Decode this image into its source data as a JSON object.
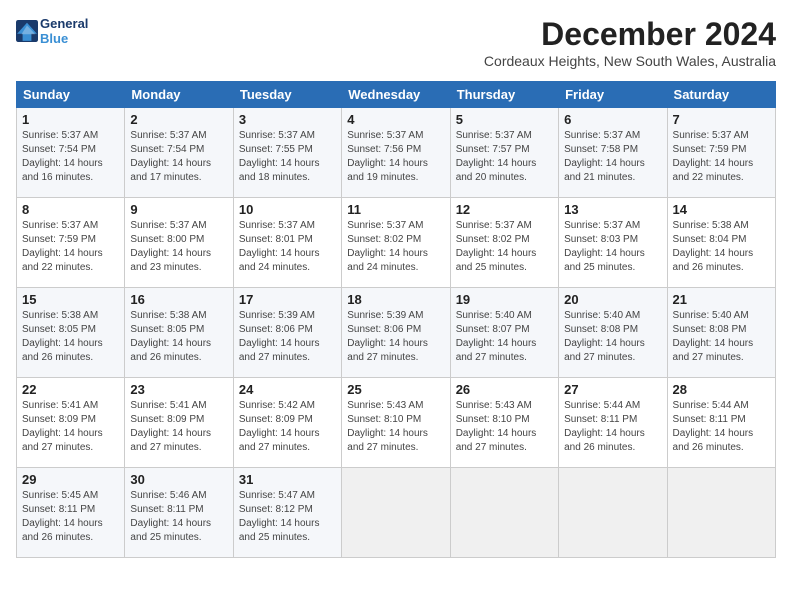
{
  "logo": {
    "text_general": "General",
    "text_blue": "Blue"
  },
  "title": "December 2024",
  "subtitle": "Cordeaux Heights, New South Wales, Australia",
  "days_of_week": [
    "Sunday",
    "Monday",
    "Tuesday",
    "Wednesday",
    "Thursday",
    "Friday",
    "Saturday"
  ],
  "weeks": [
    [
      {
        "day": "1",
        "info": "Sunrise: 5:37 AM\nSunset: 7:54 PM\nDaylight: 14 hours\nand 16 minutes."
      },
      {
        "day": "2",
        "info": "Sunrise: 5:37 AM\nSunset: 7:54 PM\nDaylight: 14 hours\nand 17 minutes."
      },
      {
        "day": "3",
        "info": "Sunrise: 5:37 AM\nSunset: 7:55 PM\nDaylight: 14 hours\nand 18 minutes."
      },
      {
        "day": "4",
        "info": "Sunrise: 5:37 AM\nSunset: 7:56 PM\nDaylight: 14 hours\nand 19 minutes."
      },
      {
        "day": "5",
        "info": "Sunrise: 5:37 AM\nSunset: 7:57 PM\nDaylight: 14 hours\nand 20 minutes."
      },
      {
        "day": "6",
        "info": "Sunrise: 5:37 AM\nSunset: 7:58 PM\nDaylight: 14 hours\nand 21 minutes."
      },
      {
        "day": "7",
        "info": "Sunrise: 5:37 AM\nSunset: 7:59 PM\nDaylight: 14 hours\nand 22 minutes."
      }
    ],
    [
      {
        "day": "8",
        "info": "Sunrise: 5:37 AM\nSunset: 7:59 PM\nDaylight: 14 hours\nand 22 minutes."
      },
      {
        "day": "9",
        "info": "Sunrise: 5:37 AM\nSunset: 8:00 PM\nDaylight: 14 hours\nand 23 minutes."
      },
      {
        "day": "10",
        "info": "Sunrise: 5:37 AM\nSunset: 8:01 PM\nDaylight: 14 hours\nand 24 minutes."
      },
      {
        "day": "11",
        "info": "Sunrise: 5:37 AM\nSunset: 8:02 PM\nDaylight: 14 hours\nand 24 minutes."
      },
      {
        "day": "12",
        "info": "Sunrise: 5:37 AM\nSunset: 8:02 PM\nDaylight: 14 hours\nand 25 minutes."
      },
      {
        "day": "13",
        "info": "Sunrise: 5:37 AM\nSunset: 8:03 PM\nDaylight: 14 hours\nand 25 minutes."
      },
      {
        "day": "14",
        "info": "Sunrise: 5:38 AM\nSunset: 8:04 PM\nDaylight: 14 hours\nand 26 minutes."
      }
    ],
    [
      {
        "day": "15",
        "info": "Sunrise: 5:38 AM\nSunset: 8:05 PM\nDaylight: 14 hours\nand 26 minutes."
      },
      {
        "day": "16",
        "info": "Sunrise: 5:38 AM\nSunset: 8:05 PM\nDaylight: 14 hours\nand 26 minutes."
      },
      {
        "day": "17",
        "info": "Sunrise: 5:39 AM\nSunset: 8:06 PM\nDaylight: 14 hours\nand 27 minutes."
      },
      {
        "day": "18",
        "info": "Sunrise: 5:39 AM\nSunset: 8:06 PM\nDaylight: 14 hours\nand 27 minutes."
      },
      {
        "day": "19",
        "info": "Sunrise: 5:40 AM\nSunset: 8:07 PM\nDaylight: 14 hours\nand 27 minutes."
      },
      {
        "day": "20",
        "info": "Sunrise: 5:40 AM\nSunset: 8:08 PM\nDaylight: 14 hours\nand 27 minutes."
      },
      {
        "day": "21",
        "info": "Sunrise: 5:40 AM\nSunset: 8:08 PM\nDaylight: 14 hours\nand 27 minutes."
      }
    ],
    [
      {
        "day": "22",
        "info": "Sunrise: 5:41 AM\nSunset: 8:09 PM\nDaylight: 14 hours\nand 27 minutes."
      },
      {
        "day": "23",
        "info": "Sunrise: 5:41 AM\nSunset: 8:09 PM\nDaylight: 14 hours\nand 27 minutes."
      },
      {
        "day": "24",
        "info": "Sunrise: 5:42 AM\nSunset: 8:09 PM\nDaylight: 14 hours\nand 27 minutes."
      },
      {
        "day": "25",
        "info": "Sunrise: 5:43 AM\nSunset: 8:10 PM\nDaylight: 14 hours\nand 27 minutes."
      },
      {
        "day": "26",
        "info": "Sunrise: 5:43 AM\nSunset: 8:10 PM\nDaylight: 14 hours\nand 27 minutes."
      },
      {
        "day": "27",
        "info": "Sunrise: 5:44 AM\nSunset: 8:11 PM\nDaylight: 14 hours\nand 26 minutes."
      },
      {
        "day": "28",
        "info": "Sunrise: 5:44 AM\nSunset: 8:11 PM\nDaylight: 14 hours\nand 26 minutes."
      }
    ],
    [
      {
        "day": "29",
        "info": "Sunrise: 5:45 AM\nSunset: 8:11 PM\nDaylight: 14 hours\nand 26 minutes."
      },
      {
        "day": "30",
        "info": "Sunrise: 5:46 AM\nSunset: 8:11 PM\nDaylight: 14 hours\nand 25 minutes."
      },
      {
        "day": "31",
        "info": "Sunrise: 5:47 AM\nSunset: 8:12 PM\nDaylight: 14 hours\nand 25 minutes."
      },
      {
        "day": "",
        "info": ""
      },
      {
        "day": "",
        "info": ""
      },
      {
        "day": "",
        "info": ""
      },
      {
        "day": "",
        "info": ""
      }
    ]
  ]
}
